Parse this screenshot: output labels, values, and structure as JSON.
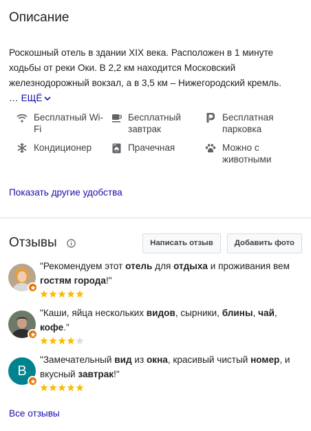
{
  "description": {
    "title": "Описание",
    "text": "Роскошный отель в здании XIX века. Расположен в 1 минуте ходьбы от реки Оки. В 2,2 км находится Московский железнодорожный вокзал, а в 3,5 км – Нижегородский кремль.",
    "ellipsis": "…",
    "more_label": "ЕЩЁ"
  },
  "amenities": [
    {
      "icon": "wifi-icon",
      "label": "Бесплатный Wi-Fi"
    },
    {
      "icon": "breakfast-icon",
      "label": "Бесплатный завтрак"
    },
    {
      "icon": "parking-icon",
      "label": "Бесплатная парковка"
    },
    {
      "icon": "snowflake-icon",
      "label": "Кондиционер"
    },
    {
      "icon": "laundry-icon",
      "label": "Прачечная"
    },
    {
      "icon": "paw-icon",
      "label": "Можно с животными"
    }
  ],
  "show_more_amenities": "Показать другие удобства",
  "reviews": {
    "title": "Отзывы",
    "write_button": "Написать отзыв",
    "add_photo_button": "Добавить фото",
    "items": [
      {
        "segments": [
          {
            "t": "\"Рекомендуем этот ",
            "b": false
          },
          {
            "t": "отель",
            "b": true
          },
          {
            "t": " для ",
            "b": false
          },
          {
            "t": "отдыха",
            "b": true
          },
          {
            "t": " и проживания вем ",
            "b": false
          },
          {
            "t": "гостям города",
            "b": true
          },
          {
            "t": "!\"",
            "b": false
          }
        ],
        "rating": 5,
        "avatar": "photo-woman"
      },
      {
        "segments": [
          {
            "t": "\"Каши, яйца нескольких ",
            "b": false
          },
          {
            "t": "видов",
            "b": true
          },
          {
            "t": ", сырники, ",
            "b": false
          },
          {
            "t": "блины",
            "b": true
          },
          {
            "t": ", ",
            "b": false
          },
          {
            "t": "чай",
            "b": true
          },
          {
            "t": ", ",
            "b": false
          },
          {
            "t": "кофе",
            "b": true
          },
          {
            "t": ".\"",
            "b": false
          }
        ],
        "rating": 4,
        "avatar": "photo-man"
      },
      {
        "segments": [
          {
            "t": "\"Замечательный ",
            "b": false
          },
          {
            "t": "вид",
            "b": true
          },
          {
            "t": " из ",
            "b": false
          },
          {
            "t": "окна",
            "b": true
          },
          {
            "t": ", красивый чистый ",
            "b": false
          },
          {
            "t": "номер",
            "b": true
          },
          {
            "t": ", и вкусный ",
            "b": false
          },
          {
            "t": "завтрак",
            "b": true
          },
          {
            "t": "!\"",
            "b": false
          }
        ],
        "rating": 5,
        "avatar": "letter",
        "letter": "B",
        "avatar_color": "#00838f"
      }
    ],
    "all_reviews_label": "Все отзывы"
  },
  "colors": {
    "link": "#1a0dab",
    "star": "#fbbc04",
    "star_empty": "#dadce0",
    "badge": "#e37400"
  }
}
